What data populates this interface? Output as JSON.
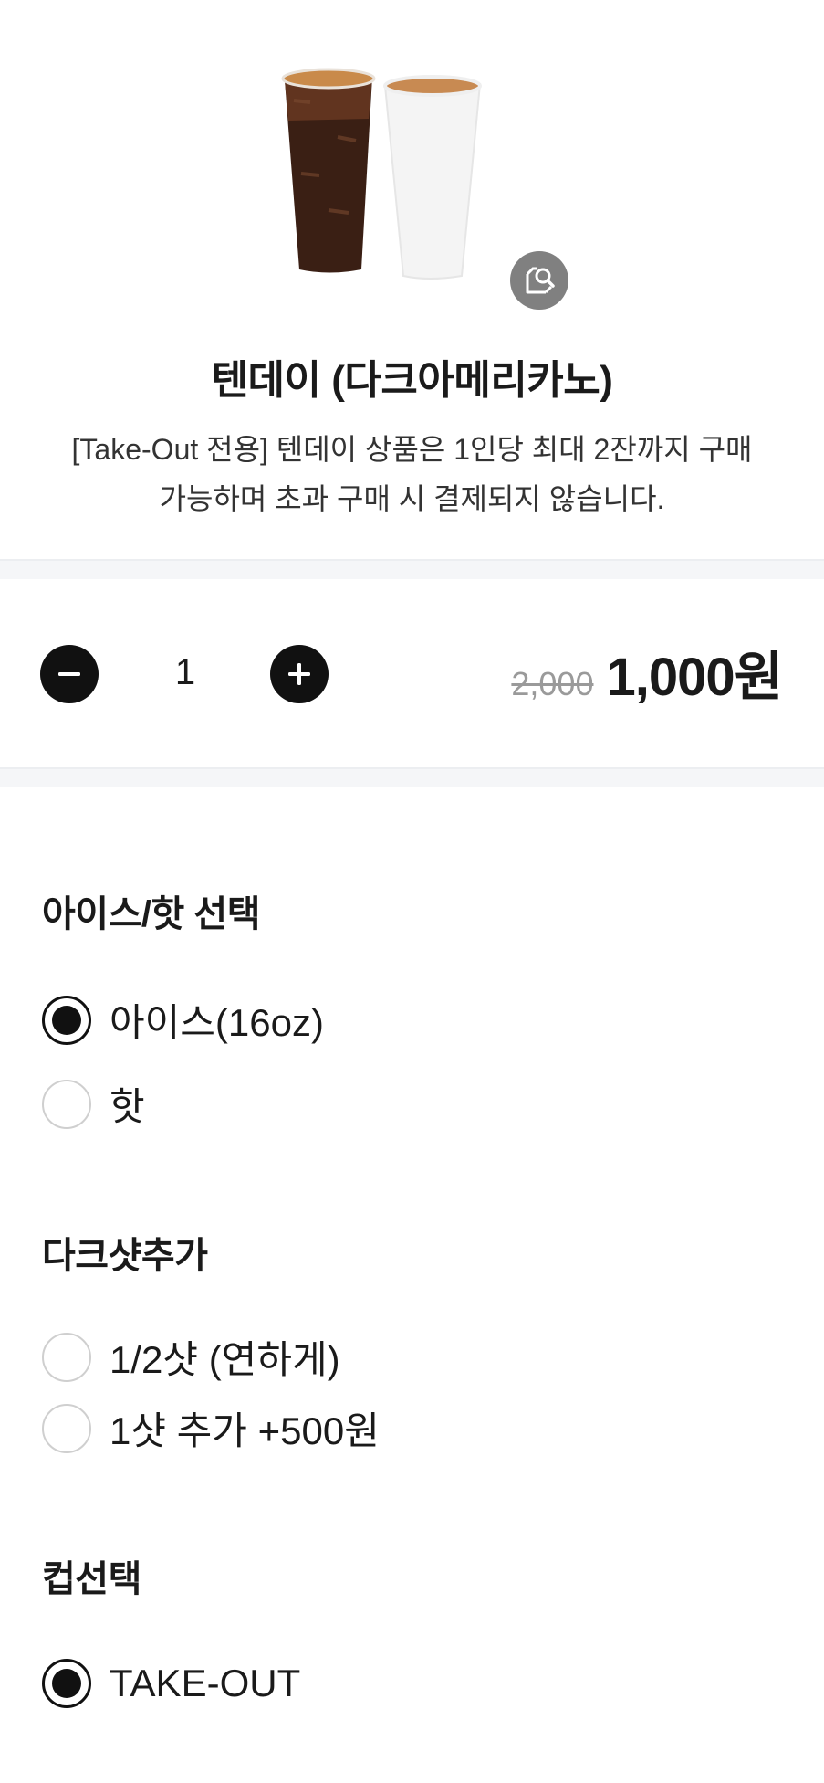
{
  "product": {
    "image_icon": "coffee-cups-image",
    "zoom_icon": "image-zoom-icon",
    "title": "텐데이 (다크아메리카노)",
    "description_line1": "[Take-Out 전용] 텐데이 상품은 1인당 최대 2잔까지 구매",
    "description_line2": "가능하며 초과 구매 시 결제되지 않습니다."
  },
  "quantity": {
    "minus_icon": "minus-icon",
    "plus_icon": "plus-icon",
    "value": "1",
    "original_price": "2,000",
    "sale_price": "1,000원"
  },
  "options": {
    "temperature": {
      "title": "아이스/핫 선택",
      "items": [
        {
          "label": "아이스(16oz)",
          "selected": true
        },
        {
          "label": "핫",
          "selected": false
        }
      ]
    },
    "dark_shot": {
      "title": "다크샷추가",
      "items": [
        {
          "label": "1/2샷 (연하게)",
          "selected": false
        },
        {
          "label": "1샷 추가 +500원",
          "selected": false
        }
      ]
    },
    "cup": {
      "title": "컵선택",
      "items": [
        {
          "label": "TAKE-OUT",
          "selected": true
        }
      ]
    }
  },
  "colors": {
    "primary": "#111111",
    "divider": "#f5f6f8",
    "muted": "#9a9a9a",
    "zoom_button": "#808080"
  }
}
